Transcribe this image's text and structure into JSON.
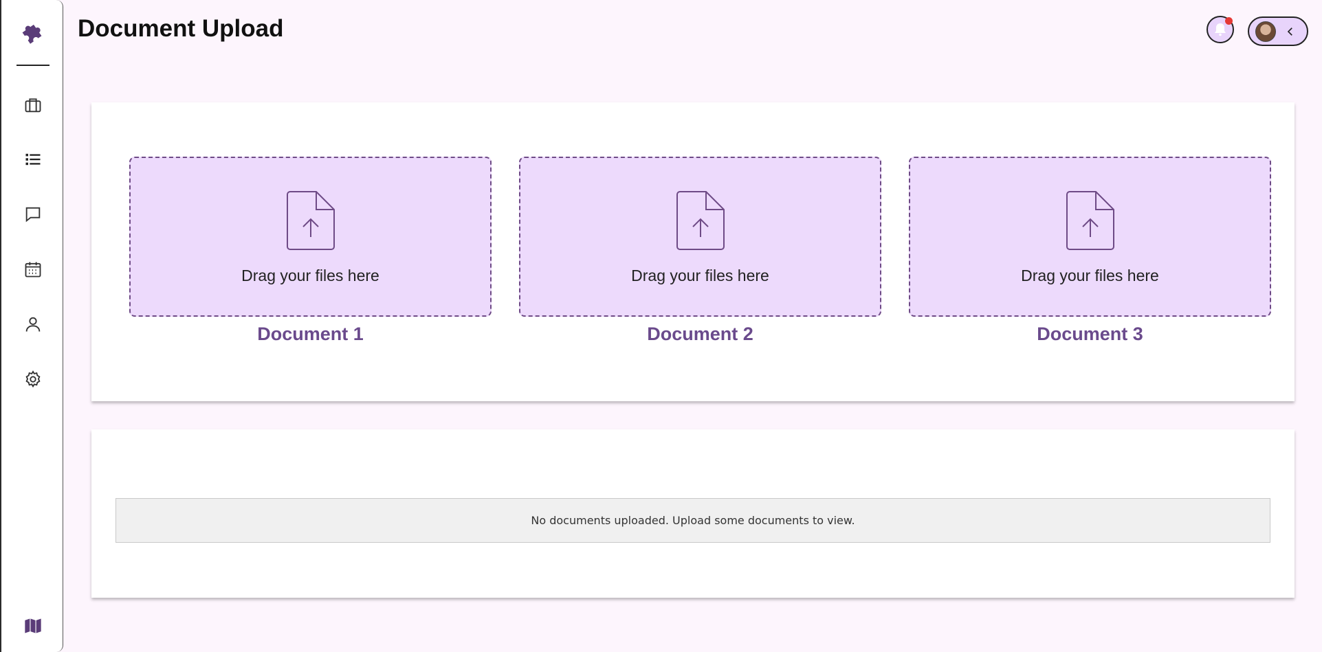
{
  "page": {
    "title": "Document Upload"
  },
  "sidebar": {
    "items": [
      {
        "name": "briefcase-icon"
      },
      {
        "name": "list-icon"
      },
      {
        "name": "chat-icon"
      },
      {
        "name": "calendar-icon"
      },
      {
        "name": "user-icon"
      },
      {
        "name": "gear-icon"
      }
    ],
    "footer_icon": "map-icon",
    "logo_icon": "puzzle-icon"
  },
  "header": {
    "notification_icon": "bell-icon",
    "has_unread": true,
    "profile_toggle_icon": "chevron-left-icon"
  },
  "upload": {
    "dropzones": [
      {
        "prompt": "Drag your files here",
        "label": "Document 1"
      },
      {
        "prompt": "Drag your files here",
        "label": "Document 2"
      },
      {
        "prompt": "Drag your files here",
        "label": "Document 3"
      }
    ]
  },
  "documents": {
    "empty_message": "No documents uploaded. Upload some documents to view."
  },
  "colors": {
    "accent": "#6a4a8c",
    "dropzone_bg": "#eddafc",
    "page_bg": "#fdf5fd",
    "notification_dot": "#e53935"
  }
}
